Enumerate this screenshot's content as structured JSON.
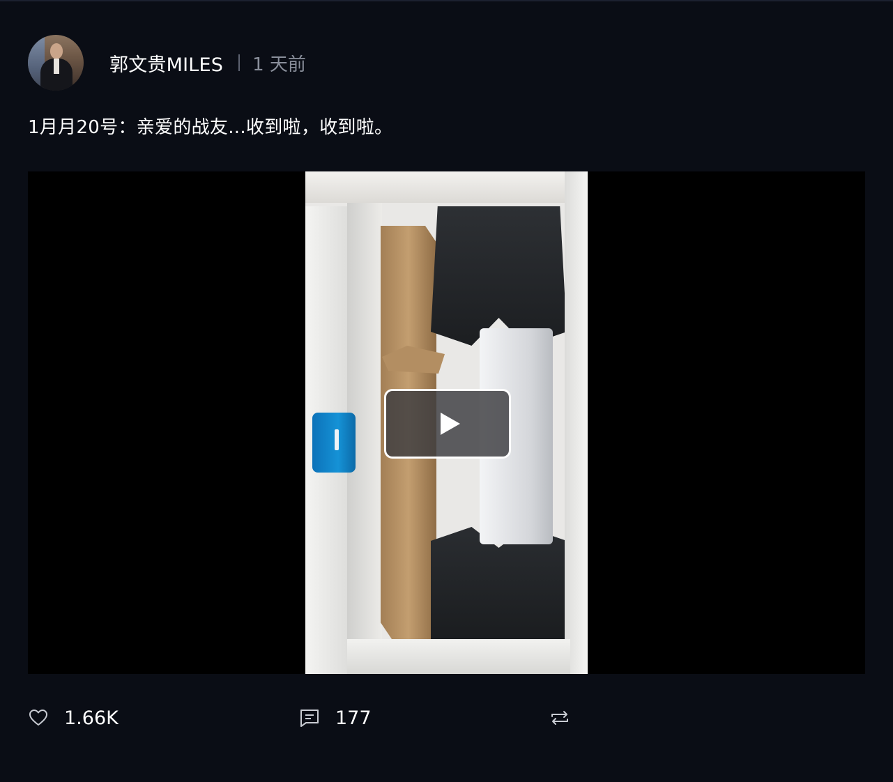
{
  "post": {
    "author": "郭文贵MILES",
    "time": "1 天前",
    "text": "1月月20号：亲爱的战友...收到啦，收到啦。"
  },
  "media": {
    "type": "video",
    "play_icon": "play-icon"
  },
  "actions": {
    "like_count": "1.66K",
    "comment_count": "177",
    "like_icon": "heart-icon",
    "comment_icon": "comment-icon",
    "repost_icon": "repost-icon"
  },
  "colors": {
    "background": "#0a0d15",
    "text": "#ffffff",
    "muted": "#8a8f9b"
  }
}
